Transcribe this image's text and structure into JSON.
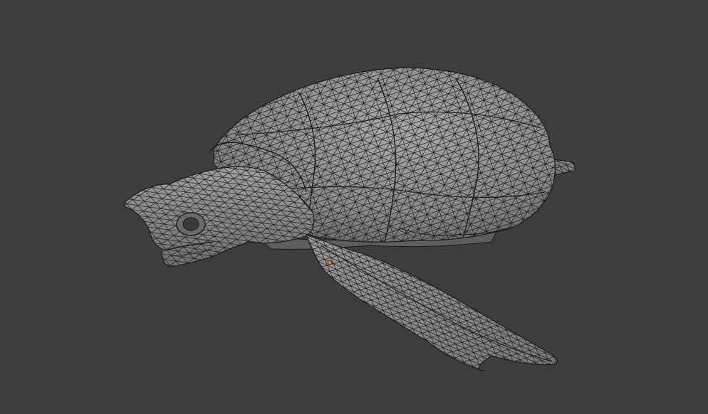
{
  "viewport": {
    "background_color": "#3d3d3d",
    "mesh_fill_color": "#8e8e8e",
    "mesh_shade_color": "#6e6e6e",
    "mesh_highlight_color": "#a6a6a6",
    "wireframe_color": "#1c1c1c",
    "origin_marker_color": "#e07a1f"
  },
  "model": {
    "subject": "sea-turtle",
    "display_mode": "wireframe-overlay"
  }
}
